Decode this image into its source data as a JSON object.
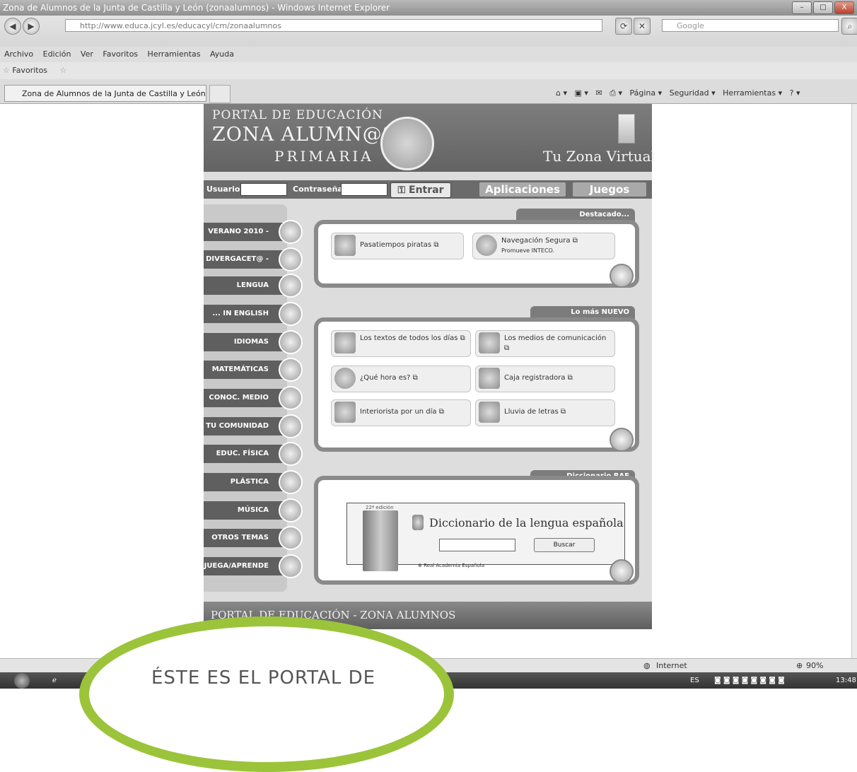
{
  "window": {
    "title": "Zona de Alumnos de la Junta de Castilla y León (zonaalumnos) - Windows Internet Explorer",
    "controls": [
      "–",
      "□",
      "X"
    ]
  },
  "address": {
    "url": "http://www.educa.jcyl.es/educacyl/cm/zonaalumnos",
    "search_placeholder": "Google"
  },
  "menu": [
    "Archivo",
    "Edición",
    "Ver",
    "Favoritos",
    "Herramientas",
    "Ayuda"
  ],
  "favorites": {
    "label": "Favoritos"
  },
  "tab": {
    "label": "Zona de Alumnos de la Junta de Castilla y León (z..."
  },
  "commandbar": [
    "Página ▾",
    "Seguridad ▾",
    "Herramientas ▾"
  ],
  "site": {
    "banner": {
      "line1": "PORTAL DE EDUCACIÓN",
      "line2": "ZONA ALUMN@S",
      "line3": "PRIMARIA",
      "tagline": "Tu Zona Virtual"
    },
    "login": {
      "user_label": "Usuario:",
      "password_label": "Contraseña:",
      "submit": "Entrar"
    },
    "top_tabs": [
      "Aplicaciones",
      "Juegos"
    ],
    "left_menu": [
      "VERANO 2010 -",
      "DIVERGACET@ -",
      "LENGUA",
      "... IN ENGLISH",
      "IDIOMAS",
      "MATEMÁTICAS",
      "CONOC. MEDIO",
      "TU COMUNIDAD",
      "EDUC. FÍSICA",
      "PLÁSTICA",
      "MÚSICA",
      "OTROS TEMAS",
      "JUEGA/APRENDE"
    ],
    "destacado": {
      "title": "Destacado...",
      "items": [
        {
          "label": "Pasatiempos piratas",
          "sub": ""
        },
        {
          "label": "Navegación Segura",
          "sub": "Promueve INTECO."
        }
      ]
    },
    "nuevo": {
      "title": "Lo más NUEVO",
      "items": [
        "Los textos de todos los días",
        "Los medios de comunicación",
        "¿Qué hora es?",
        "Caja registradora",
        "Interiorista por un día",
        "Lluvia de letras"
      ]
    },
    "diccionario": {
      "title": "Diccionario RAE",
      "edition": "22ª edición",
      "heading": "Diccionario de la lengua española",
      "button": "Buscar",
      "credit": "Real Academia Española"
    },
    "footer": "PORTAL DE EDUCACIÓN - ZONA ALUMNOS"
  },
  "status": {
    "zone": "Internet",
    "zoom": "90%"
  },
  "taskbar": {
    "lang": "ES",
    "time": "13:48"
  },
  "callout": {
    "text": "ÉSTE ES EL PORTAL DE"
  }
}
